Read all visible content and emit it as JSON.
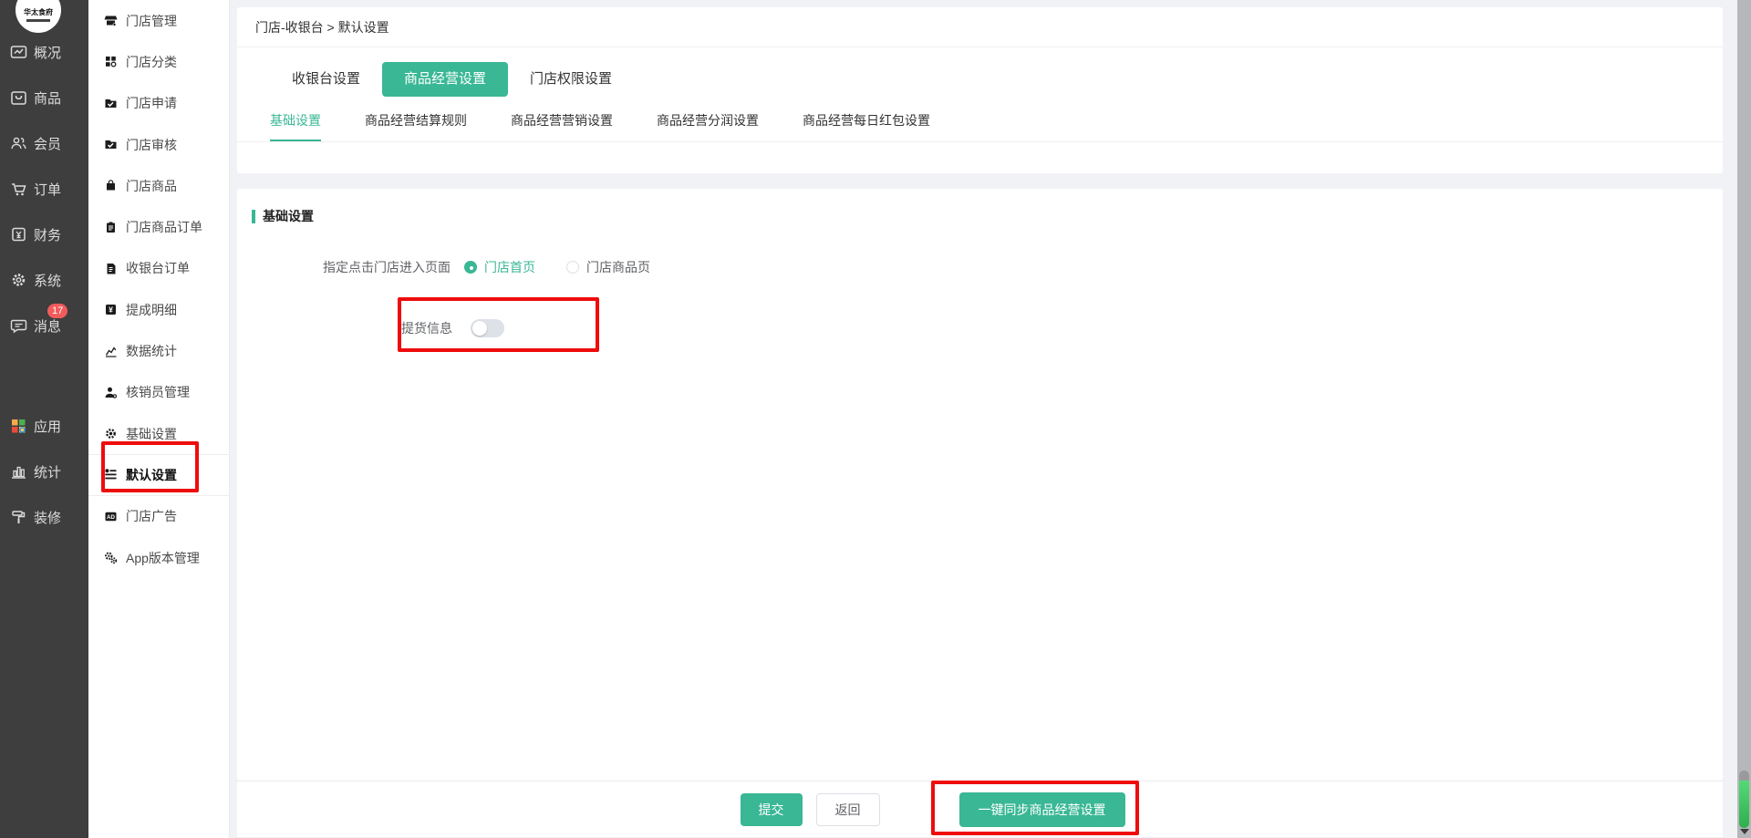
{
  "colors": {
    "accent": "#3ab795",
    "annotation": "#ee0c0c",
    "badge": "#f15b5b",
    "scroll_thumb": "#3fc561"
  },
  "logo": {
    "text": "华太食府"
  },
  "primary_sidebar": {
    "items": [
      {
        "key": "overview",
        "label": "概况",
        "icon": "overview-icon"
      },
      {
        "key": "goods",
        "label": "商品",
        "icon": "goods-icon"
      },
      {
        "key": "member",
        "label": "会员",
        "icon": "member-icon"
      },
      {
        "key": "order",
        "label": "订单",
        "icon": "cart-icon"
      },
      {
        "key": "finance",
        "label": "财务",
        "icon": "finance-icon"
      },
      {
        "key": "system",
        "label": "系统",
        "icon": "gear-outline-icon"
      },
      {
        "key": "message",
        "label": "消息",
        "icon": "chat-bubble-icon",
        "badge": "17"
      },
      {
        "key": "apps",
        "label": "应用",
        "icon": "apps-grid-icon",
        "spacer_before": true
      },
      {
        "key": "stats",
        "label": "统计",
        "icon": "bar-chart-icon"
      },
      {
        "key": "decorate",
        "label": "装修",
        "icon": "paint-roller-icon"
      }
    ]
  },
  "secondary_sidebar": {
    "items": [
      {
        "key": "store-management",
        "label": "门店管理",
        "icon": "storefront-icon"
      },
      {
        "key": "store-category",
        "label": "门店分类",
        "icon": "category-grid-icon"
      },
      {
        "key": "store-apply",
        "label": "门店申请",
        "icon": "folder-check-icon"
      },
      {
        "key": "store-review",
        "label": "门店审核",
        "icon": "folder-check-icon"
      },
      {
        "key": "store-goods",
        "label": "门店商品",
        "icon": "bag-icon"
      },
      {
        "key": "store-goods-order",
        "label": "门店商品订单",
        "icon": "clipboard-icon"
      },
      {
        "key": "cashier-order",
        "label": "收银台订单",
        "icon": "receipt-icon"
      },
      {
        "key": "commission-detail",
        "label": "提成明细",
        "icon": "yen-square-icon"
      },
      {
        "key": "data-stats",
        "label": "数据统计",
        "icon": "line-chart-icon"
      },
      {
        "key": "verifier-management",
        "label": "核销员管理",
        "icon": "person-gear-icon"
      },
      {
        "key": "basic-settings",
        "label": "基础设置",
        "icon": "gear-icon"
      },
      {
        "key": "default-settings",
        "label": "默认设置",
        "icon": "sliders-list-icon",
        "selected": true
      },
      {
        "key": "store-ad",
        "label": "门店广告",
        "icon": "ad-badge-icon"
      },
      {
        "key": "app-version",
        "label": "App版本管理",
        "icon": "double-gear-icon"
      }
    ]
  },
  "breadcrumb": {
    "text": "门店-收银台 > 默认设置"
  },
  "tabs": {
    "items": [
      {
        "key": "cashier-settings",
        "label": "收银台设置",
        "active": false
      },
      {
        "key": "goods-operation-settings",
        "label": "商品经营设置",
        "active": true
      },
      {
        "key": "store-permission-settings",
        "label": "门店权限设置",
        "active": false
      }
    ]
  },
  "subtabs": {
    "items": [
      {
        "key": "basic-settings",
        "label": "基础设置",
        "active": true
      },
      {
        "key": "settlement-rules",
        "label": "商品经营结算规则",
        "active": false
      },
      {
        "key": "marketing-settings",
        "label": "商品经营营销设置",
        "active": false
      },
      {
        "key": "profit-sharing-settings",
        "label": "商品经营分润设置",
        "active": false
      },
      {
        "key": "daily-redpacket-settings",
        "label": "商品经营每日红包设置",
        "active": false
      }
    ]
  },
  "form": {
    "section_title": "基础设置",
    "entry_page": {
      "label": "指定点击门店进入页面",
      "options": [
        {
          "key": "store-home",
          "label": "门店首页",
          "selected": true
        },
        {
          "key": "store-goods-page",
          "label": "门店商品页",
          "selected": false
        }
      ]
    },
    "pickup": {
      "label": "提货信息",
      "enabled": false
    }
  },
  "footer": {
    "submit_label": "提交",
    "back_label": "返回",
    "sync_label": "一键同步商品经营设置"
  }
}
